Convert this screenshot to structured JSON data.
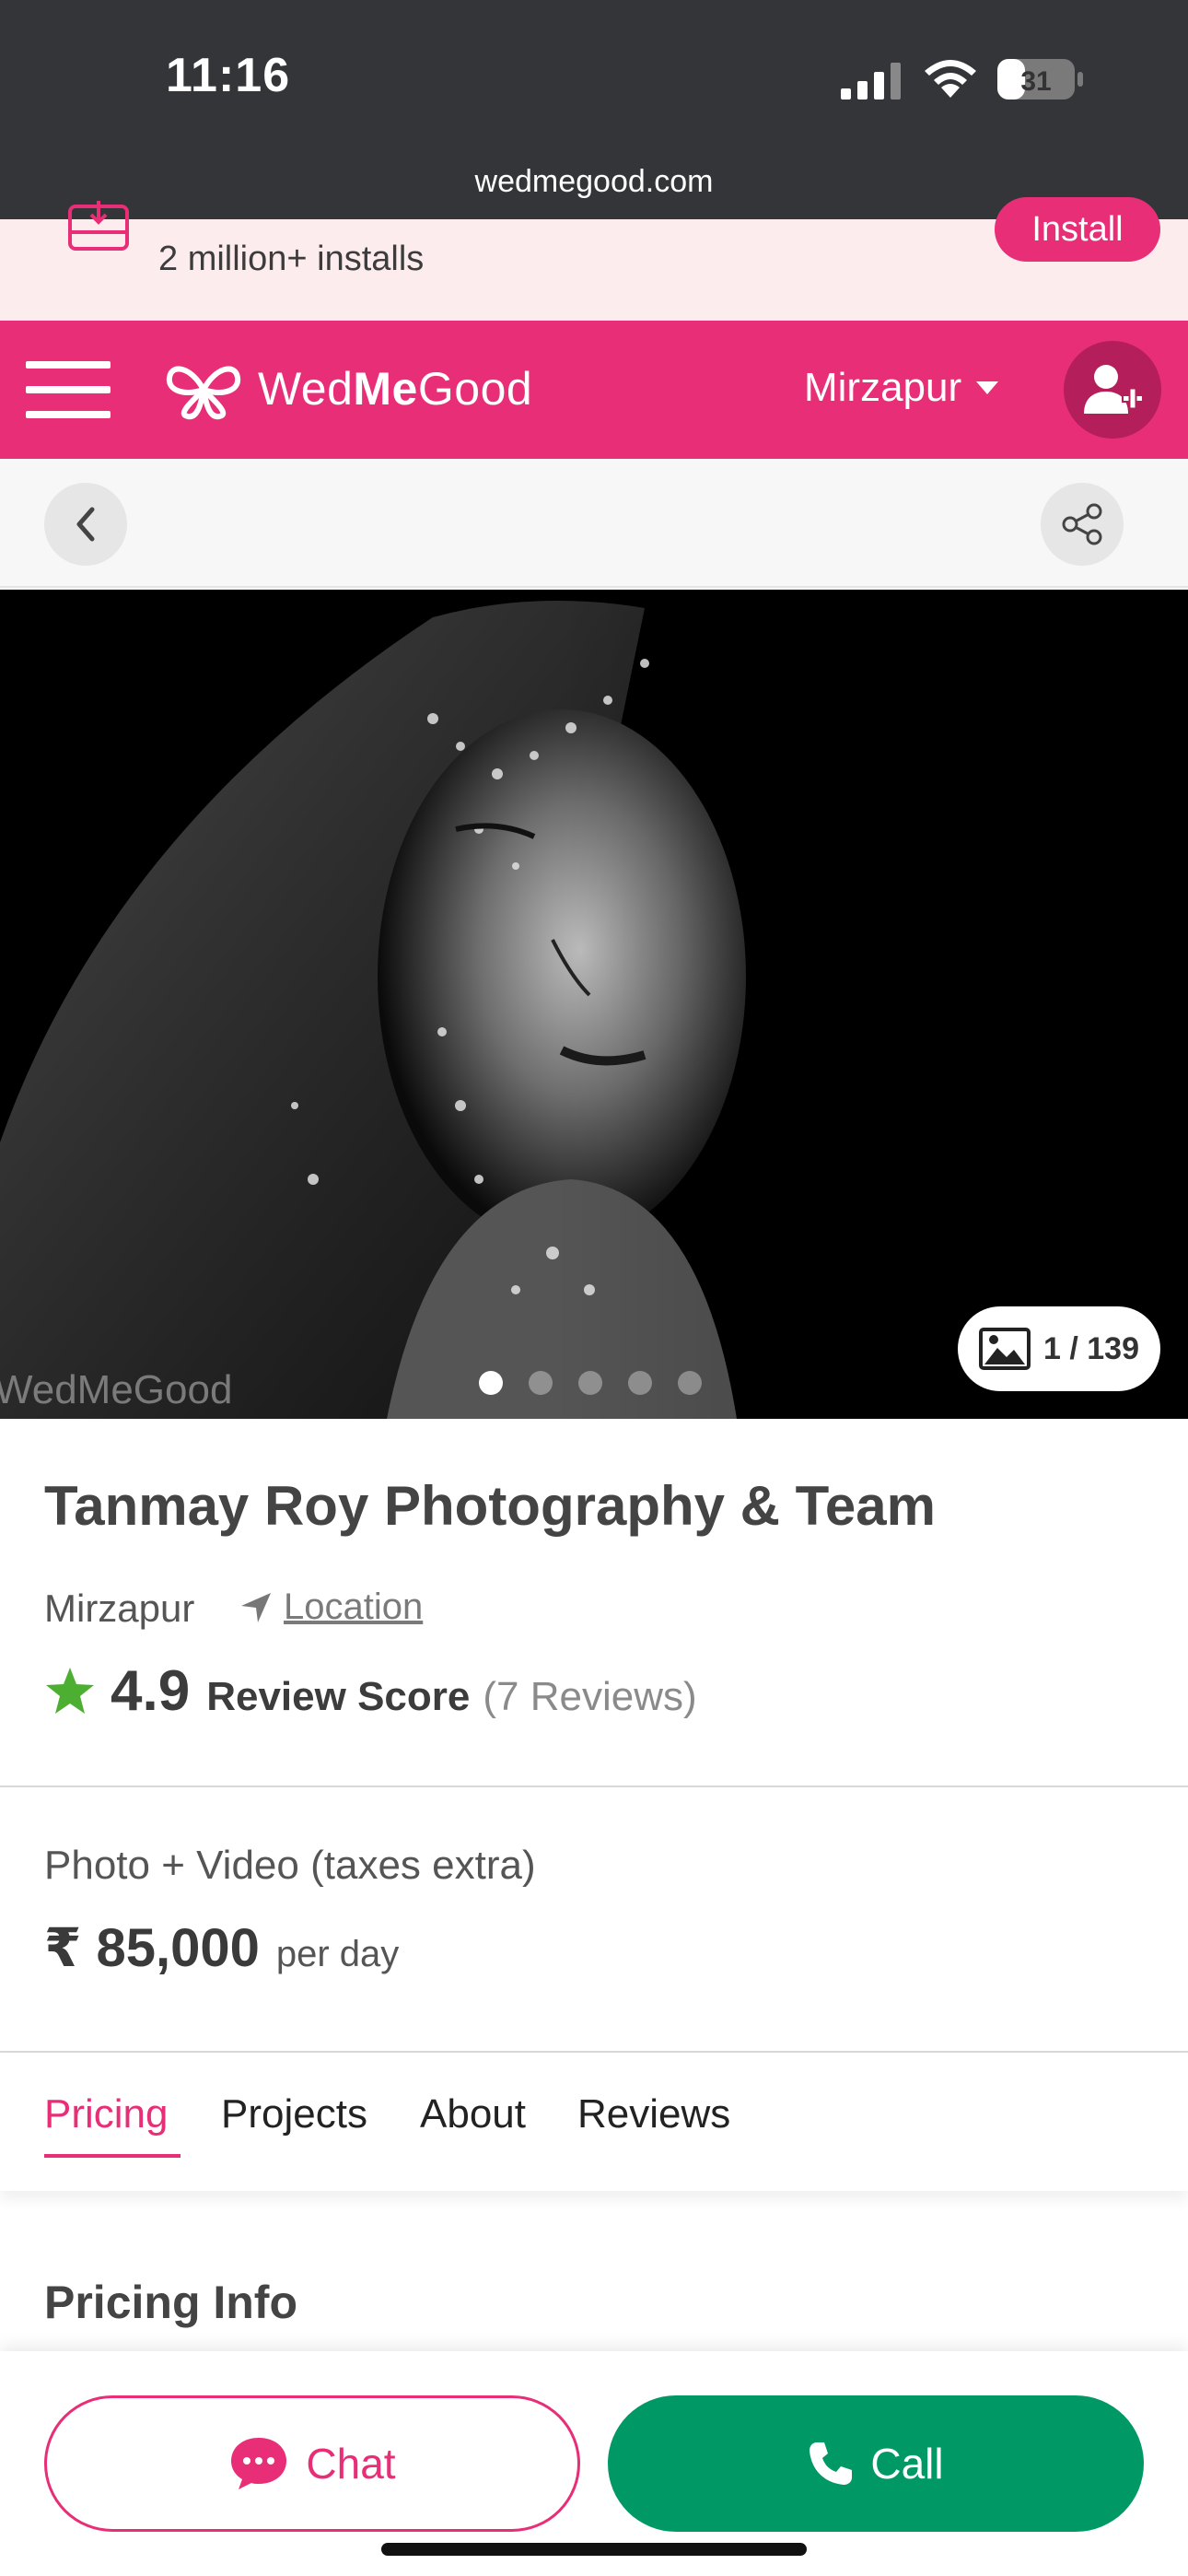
{
  "status_bar": {
    "time": "11:16",
    "battery": "31"
  },
  "browser": {
    "url": "wedmegood.com"
  },
  "install_banner": {
    "text": "2 million+ installs",
    "button": "Install"
  },
  "header": {
    "logo_light": "Wed",
    "logo_bold": "Me",
    "logo_tail": "Good",
    "city": "Mirzapur"
  },
  "gallery": {
    "watermark": "WedMeGood",
    "counter": "1 / 139",
    "dots_total": 5,
    "active_dot": 0
  },
  "vendor": {
    "name": "Tanmay Roy Photography & Team",
    "city": "Mirzapur",
    "location_link": "Location",
    "rating": "4.9",
    "rating_label": "Review Score",
    "reviews": "(7 Reviews)"
  },
  "pricing": {
    "label": "Photo + Video (taxes extra)",
    "price": "₹ 85,000",
    "unit": "per day"
  },
  "tabs": [
    {
      "label": "Pricing"
    },
    {
      "label": "Projects"
    },
    {
      "label": "About"
    },
    {
      "label": "Reviews"
    }
  ],
  "active_tab": "Pricing",
  "section": {
    "title": "Pricing Info"
  },
  "actions": {
    "chat": "Chat",
    "call": "Call"
  },
  "colors": {
    "brand": "#e72e77",
    "call": "#009966",
    "star": "#4caf32"
  }
}
